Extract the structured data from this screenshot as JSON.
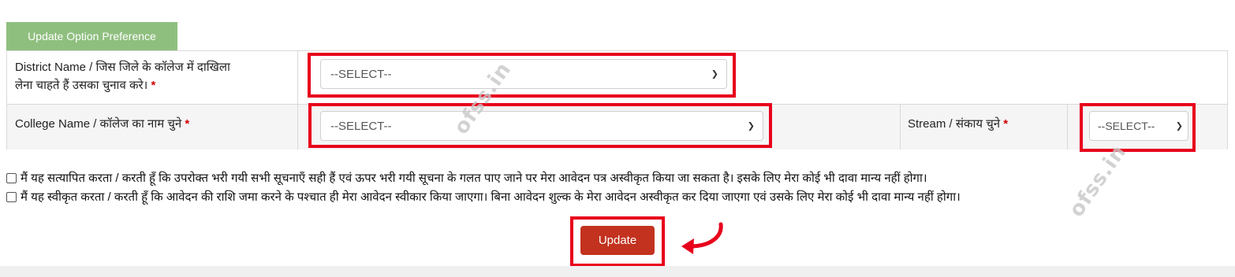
{
  "section": {
    "tab_label": "Update Option Preference"
  },
  "fields": {
    "district": {
      "label_line1": "District Name / जिस जिले के कॉलेज में दाखिला",
      "label_line2": "लेना चाहते हैं उसका चुनाव करे।",
      "required_mark": "*",
      "value": "--SELECT--"
    },
    "college": {
      "label": "College Name / कॉलेज का नाम चुने",
      "required_mark": "*",
      "value": "--SELECT--"
    },
    "stream": {
      "label": "Stream / संकाय चुने",
      "required_mark": "*",
      "value": "--SELECT--"
    }
  },
  "consents": [
    {
      "text": "मैं यह सत्यापित करता / करती हूँ कि उपरोक्त भरी गयी सभी सूचनाएँ सही हैं एवं ऊपर भरी गयी सूचना के गलत पाए जाने पर मेरा आवेदन पत्र अस्वीकृत किया जा सकता है। इसके लिए मेरा कोई भी दावा मान्य नहीं होगा।",
      "checked": false
    },
    {
      "text": "मैं यह स्वीकृत करता / करती हूँ कि आवेदन की राशि जमा करने के पश्चात ही मेरा आवेदन स्वीकार किया जाएगा। बिना आवेदन शुल्क के मेरा आवेदन अस्वीकृत कर दिया जाएगा एवं उसके लिए मेरा कोई भी दावा मान्य नहीं होगा।",
      "checked": false
    }
  ],
  "actions": {
    "update_label": "Update"
  },
  "watermark": {
    "text": "ofss.in"
  },
  "colors": {
    "tab_bg": "#8fbf7f",
    "highlight": "#e8001c",
    "button_bg": "#c2321f",
    "required": "#d00000"
  },
  "icons": {
    "select_chevron": "chevron-down-icon",
    "pointer_arrow": "curved-arrow-icon"
  }
}
